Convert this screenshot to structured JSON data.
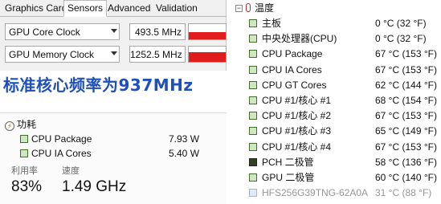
{
  "gpuz": {
    "tabs": [
      "Graphics Card",
      "Sensors",
      "Advanced",
      "Validation"
    ],
    "active_tab": "Sensors",
    "sensors": [
      {
        "name": "GPU Core Clock",
        "value": "493.5 MHz",
        "graph_level": 0.45
      },
      {
        "name": "GPU Memory Clock",
        "value": "1252.5 MHz",
        "graph_level": 0.65
      }
    ]
  },
  "caption": "标准核心频率为937MHz",
  "power": {
    "title": "功耗",
    "items": [
      {
        "label": "CPU Package",
        "value": "7.93 W"
      },
      {
        "label": "CPU IA Cores",
        "value": "5.40 W"
      }
    ],
    "util_label": "利用率",
    "util_value": "83%",
    "speed_label": "速度",
    "speed_value": "1.49 GHz"
  },
  "temps": {
    "header": "温度",
    "rows": [
      {
        "label": "主板",
        "value": "0 °C  (32 °F)",
        "icon": "board-icon"
      },
      {
        "label": "中央处理器(CPU)",
        "value": "0 °C  (32 °F)",
        "icon": "cpu-icon"
      },
      {
        "label": "CPU Package",
        "value": "67 °C  (153 °F)",
        "icon": "cpu-icon"
      },
      {
        "label": "CPU IA Cores",
        "value": "67 °C  (153 °F)",
        "icon": "cpu-icon"
      },
      {
        "label": "CPU GT Cores",
        "value": "62 °C  (144 °F)",
        "icon": "cpu-icon"
      },
      {
        "label": "CPU #1/核心 #1",
        "value": "68 °C  (154 °F)",
        "icon": "cpu-icon"
      },
      {
        "label": "CPU #1/核心 #2",
        "value": "67 °C  (153 °F)",
        "icon": "cpu-icon"
      },
      {
        "label": "CPU #1/核心 #3",
        "value": "65 °C  (149 °F)",
        "icon": "cpu-icon"
      },
      {
        "label": "CPU #1/核心 #4",
        "value": "67 °C  (153 °F)",
        "icon": "cpu-icon"
      },
      {
        "label": "PCH 二极管",
        "value": "58 °C  (136 °F)",
        "icon": "pch-icon"
      },
      {
        "label": "GPU 二极管",
        "value": "60 °C  (140 °F)",
        "icon": "gpu-icon"
      },
      {
        "label": "HFS256G39TNG-62A0A",
        "value": "31 °C  (88 °F)",
        "icon": "drive-icon"
      }
    ]
  },
  "colors": {
    "graph_red": "#e01c1c",
    "caption_blue": "#1f4fb8",
    "chip_green": "#cfe6c1"
  }
}
